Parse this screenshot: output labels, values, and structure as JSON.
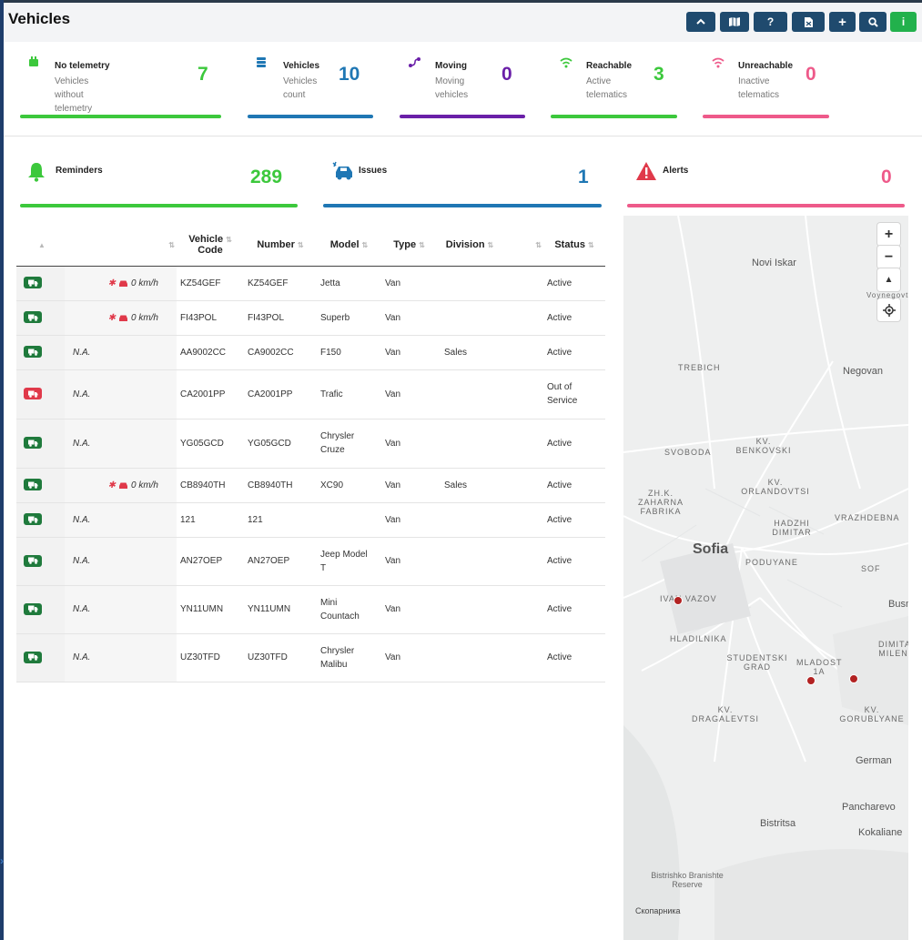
{
  "page": {
    "title": "Vehicles"
  },
  "toolbar": {
    "buttons": [
      {
        "icon": "chevron-up-icon"
      },
      {
        "icon": "map-icon"
      },
      {
        "icon": "help-icon"
      },
      {
        "icon": "export-icon"
      },
      {
        "icon": "plus-icon"
      },
      {
        "icon": "search-icon"
      },
      {
        "icon": "info-icon"
      }
    ]
  },
  "stats": [
    {
      "title": "No telemetry",
      "sub1": "Vehicles without",
      "sub2": "telemetry",
      "value": "7",
      "color": "#3cc83c"
    },
    {
      "title": "Vehicles",
      "sub1": "Vehicles",
      "sub2": "count",
      "value": "10",
      "color": "#1f77b4"
    },
    {
      "title": "Moving",
      "sub1": "Moving",
      "sub2": "vehicles",
      "value": "0",
      "color": "#6a1fa8"
    },
    {
      "title": "Reachable",
      "sub1": "Active",
      "sub2": "telematics",
      "value": "3",
      "color": "#3cc83c"
    },
    {
      "title": "Unreachable",
      "sub1": "Inactive",
      "sub2": "telematics",
      "value": "0",
      "color": "#ee5a8a"
    }
  ],
  "big_stats": [
    {
      "title": "Reminders",
      "value": "289",
      "color": "#3cc83c"
    },
    {
      "title": "Issues",
      "value": "1",
      "color": "#1f77b4"
    },
    {
      "title": "Alerts",
      "value": "0",
      "color": "#ee5a8a"
    }
  ],
  "table": {
    "headers": [
      "",
      "",
      "Vehicle Code",
      "Number",
      "Model",
      "Type",
      "Division",
      "",
      "Status"
    ],
    "header_code_line1": "Vehicle",
    "header_code_line2": "Code",
    "rows": [
      {
        "state": "on",
        "speed": "0 km/h",
        "na": "",
        "code": "KZ54GEF",
        "number": "KZ54GEF",
        "model": "Jetta",
        "model2": "",
        "type": "Van",
        "division": "",
        "status": "Active",
        "status2": ""
      },
      {
        "state": "on",
        "speed": "0 km/h",
        "na": "",
        "code": "FI43POL",
        "number": "FI43POL",
        "model": "Superb",
        "model2": "",
        "type": "Van",
        "division": "",
        "status": "Active",
        "status2": ""
      },
      {
        "state": "on",
        "speed": "",
        "na": "N.A.",
        "code": "AA9002CC",
        "number": "CA9002CC",
        "model": "F150",
        "model2": "",
        "type": "Van",
        "division": "Sales",
        "status": "Active",
        "status2": ""
      },
      {
        "state": "off",
        "speed": "",
        "na": "N.A.",
        "code": "CA2001PP",
        "number": "CA2001PP",
        "model": "Trafic",
        "model2": "",
        "type": "Van",
        "division": "",
        "status": "Out of",
        "status2": "Service"
      },
      {
        "state": "on",
        "speed": "",
        "na": "N.A.",
        "code": "YG05GCD",
        "number": "YG05GCD",
        "model": "Chrysler",
        "model2": "Cruze",
        "type": "Van",
        "division": "",
        "status": "Active",
        "status2": ""
      },
      {
        "state": "on",
        "speed": "0 km/h",
        "na": "",
        "code": "CB8940TH",
        "number": "CB8940TH",
        "model": "XC90",
        "model2": "",
        "type": "Van",
        "division": "Sales",
        "status": "Active",
        "status2": ""
      },
      {
        "state": "on",
        "speed": "",
        "na": "N.A.",
        "code": "121",
        "number": "121",
        "model": "",
        "model2": "",
        "type": "Van",
        "division": "",
        "status": "Active",
        "status2": ""
      },
      {
        "state": "on",
        "speed": "",
        "na": "N.A.",
        "code": "AN27OEP",
        "number": "AN27OEP",
        "model": "Jeep Model",
        "model2": "T",
        "type": "Van",
        "division": "",
        "status": "Active",
        "status2": ""
      },
      {
        "state": "on",
        "speed": "",
        "na": "N.A.",
        "code": "YN11UMN",
        "number": "YN11UMN",
        "model": "Mini",
        "model2": "Countach",
        "type": "Van",
        "division": "",
        "status": "Active",
        "status2": ""
      },
      {
        "state": "on",
        "speed": "",
        "na": "N.A.",
        "code": "UZ30TFD",
        "number": "UZ30TFD",
        "model": "Chrysler",
        "model2": "Malibu",
        "type": "Van",
        "division": "",
        "status": "Active",
        "status2": ""
      }
    ]
  },
  "map": {
    "zoom_in": "+",
    "zoom_out": "−",
    "labels": [
      "Novi Iskar",
      "Voynegovtsi",
      "TREBICH",
      "Negovan",
      "SVOBODA",
      "KV. BENKOVSKI",
      "ZH.K. ZAHARNA FABRIKA",
      "KV. ORLANDOVTSI",
      "HADZHI DIMITAR",
      "VRAZHDEBNA",
      "Sofia",
      "PODUYANE",
      "SOF",
      "IVAN VAZOV",
      "Busm",
      "HLADILNIKA",
      "STUDENTSKI GRAD",
      "MLADOST 1A",
      "DIMITAR MILEN",
      "KV. DRAGALEVTSI",
      "KV. GORUBLYANE",
      "German",
      "Pancharevo",
      "Bistritsa",
      "Kokaliane",
      "Bistrishko Branishte Reserve",
      "Скопарника"
    ]
  }
}
